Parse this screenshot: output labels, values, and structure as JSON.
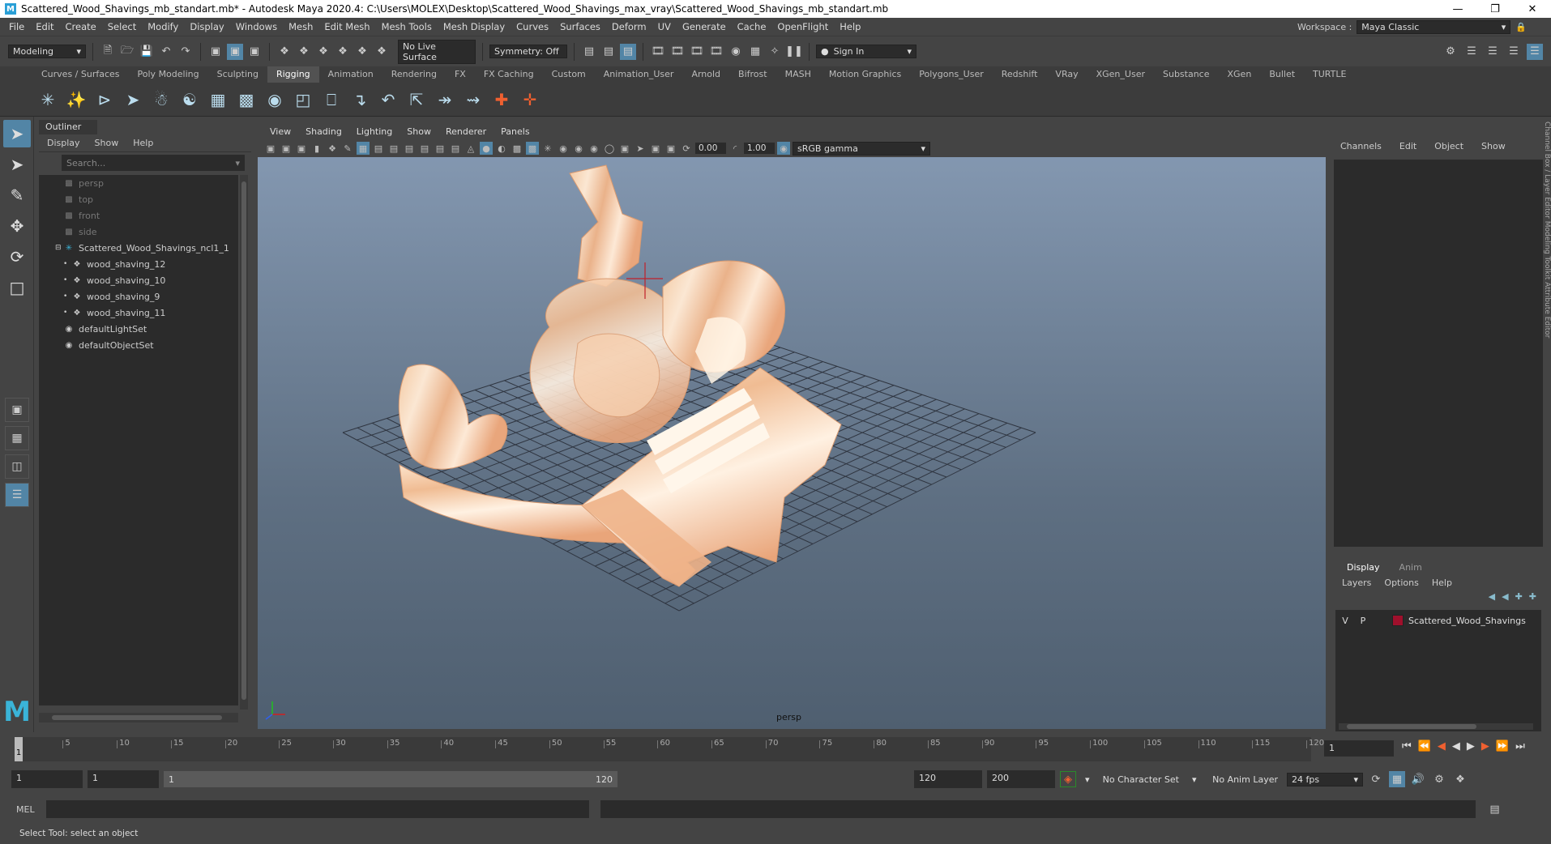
{
  "window": {
    "title": "Scattered_Wood_Shavings_mb_standart.mb* - Autodesk Maya 2020.4: C:\\Users\\MOLEX\\Desktop\\Scattered_Wood_Shavings_max_vray\\Scattered_Wood_Shavings_mb_standart.mb"
  },
  "menu": [
    "File",
    "Edit",
    "Create",
    "Select",
    "Modify",
    "Display",
    "Windows",
    "Mesh",
    "Edit Mesh",
    "Mesh Tools",
    "Mesh Display",
    "Curves",
    "Surfaces",
    "Deform",
    "UV",
    "Generate",
    "Cache",
    "OpenFlight",
    "Help"
  ],
  "workspace": {
    "label": "Workspace :",
    "value": "Maya Classic"
  },
  "statusline": {
    "mode": "Modeling",
    "live_surface": "No Live Surface",
    "symmetry": "Symmetry: Off",
    "sign_in": "Sign In"
  },
  "shelf_tabs": [
    "Curves / Surfaces",
    "Poly Modeling",
    "Sculpting",
    "Rigging",
    "Animation",
    "Rendering",
    "FX",
    "FX Caching",
    "Custom",
    "Animation_User",
    "Arnold",
    "Bifrost",
    "MASH",
    "Motion Graphics",
    "Polygons_User",
    "Redshift",
    "VRay",
    "XGen_User",
    "Substance",
    "XGen",
    "Bullet",
    "TURTLE"
  ],
  "active_shelf": "Rigging",
  "outliner": {
    "tab": "Outliner",
    "menu": [
      "Display",
      "Show",
      "Help"
    ],
    "search_placeholder": "Search...",
    "items": [
      {
        "label": "persp",
        "indent": 1,
        "dim": true,
        "icon": "camera-icon"
      },
      {
        "label": "top",
        "indent": 1,
        "dim": true,
        "icon": "camera-icon"
      },
      {
        "label": "front",
        "indent": 1,
        "dim": true,
        "icon": "camera-icon"
      },
      {
        "label": "side",
        "indent": 1,
        "dim": true,
        "icon": "camera-icon"
      },
      {
        "label": "Scattered_Wood_Shavings_ncl1_1",
        "indent": 1,
        "dim": false,
        "icon": "joint-icon",
        "expanded": true
      },
      {
        "label": "wood_shaving_12",
        "indent": 2,
        "dim": false,
        "icon": "mesh-icon"
      },
      {
        "label": "wood_shaving_10",
        "indent": 2,
        "dim": false,
        "icon": "mesh-icon"
      },
      {
        "label": "wood_shaving_9",
        "indent": 2,
        "dim": false,
        "icon": "mesh-icon"
      },
      {
        "label": "wood_shaving_11",
        "indent": 2,
        "dim": false,
        "icon": "mesh-icon"
      },
      {
        "label": "defaultLightSet",
        "indent": 1,
        "dim": false,
        "icon": "set-icon"
      },
      {
        "label": "defaultObjectSet",
        "indent": 1,
        "dim": false,
        "icon": "set-icon"
      }
    ]
  },
  "viewport": {
    "menu": [
      "View",
      "Shading",
      "Lighting",
      "Show",
      "Renderer",
      "Panels"
    ],
    "exposure": "0.00",
    "gamma": "1.00",
    "color_space": "sRGB gamma",
    "camera": "persp",
    "colors": {
      "wood_light": "#f6d7b8",
      "wood_dark": "#e8a77c",
      "grid": "#2f3540"
    }
  },
  "channel_box": {
    "menu": [
      "Channels",
      "Edit",
      "Object",
      "Show"
    ]
  },
  "side_tabs": "Channel Box / Layer Editor   Modeling Toolkit   Attribute Editor",
  "layer_editor": {
    "tabs": [
      "Display",
      "Anim"
    ],
    "menu": [
      "Layers",
      "Options",
      "Help"
    ],
    "layer": {
      "v": "V",
      "p": "P",
      "name": "Scattered_Wood_Shavings",
      "color": "#a0102c"
    }
  },
  "timeline": {
    "ticks": [
      "1",
      "5",
      "10",
      "15",
      "20",
      "25",
      "30",
      "35",
      "40",
      "45",
      "50",
      "55",
      "60",
      "65",
      "70",
      "75",
      "80",
      "85",
      "90",
      "95",
      "100",
      "105",
      "110",
      "115",
      "120"
    ],
    "current_frame": "1",
    "frame_field": "1"
  },
  "range": {
    "start": "1",
    "playback_start": "1",
    "slider_start": "1",
    "slider_end": "120",
    "playback_end": "120",
    "end": "200",
    "character_set": "No Character Set",
    "anim_layer": "No Anim Layer",
    "fps": "24 fps"
  },
  "mel": {
    "label": "MEL"
  },
  "help_line": "Select Tool: select an object"
}
